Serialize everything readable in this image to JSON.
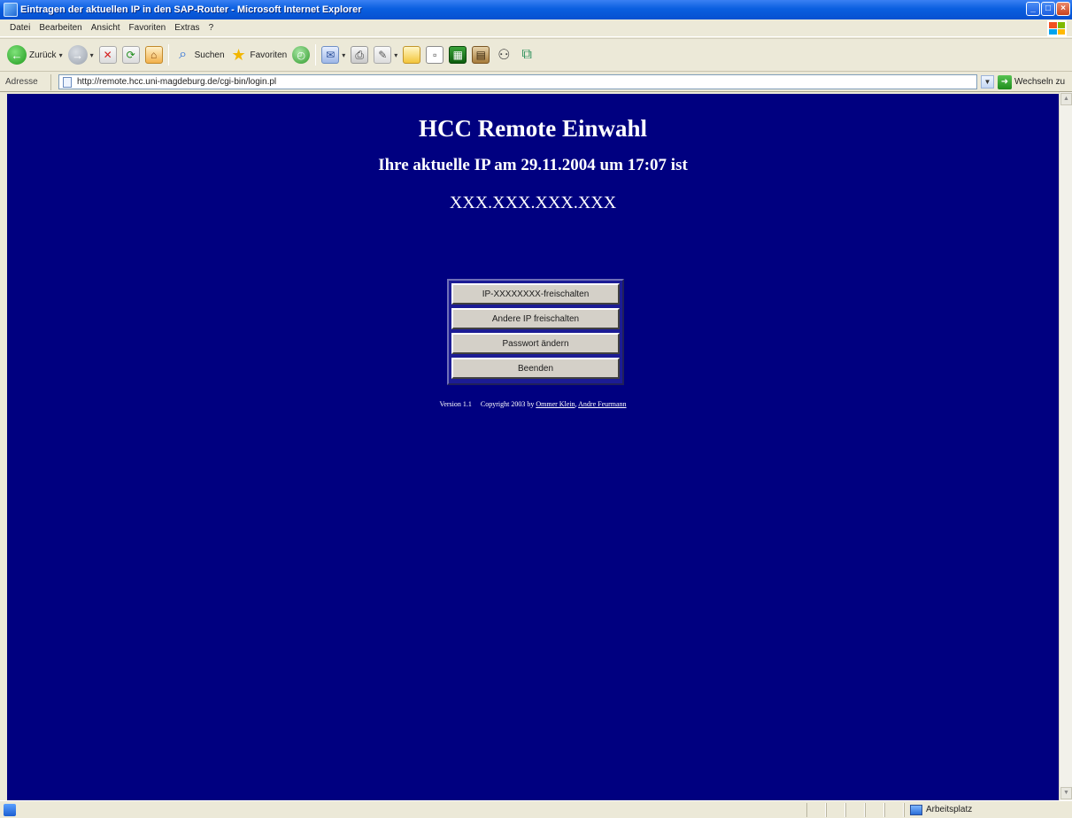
{
  "window": {
    "title": "Eintragen der aktuellen IP in den SAP-Router - Microsoft Internet Explorer",
    "controls": {
      "minimize": "_",
      "maximize": "□",
      "close": "×"
    }
  },
  "menubar": {
    "items": [
      "Datei",
      "Bearbeiten",
      "Ansicht",
      "Favoriten",
      "Extras",
      "?"
    ]
  },
  "toolbar": {
    "back_label": "Zurück",
    "search_label": "Suchen",
    "favorites_label": "Favoriten"
  },
  "address": {
    "label": "Adresse",
    "url": "http://remote.hcc.uni-magdeburg.de/cgi-bin/login.pl",
    "go_label": "Wechseln zu"
  },
  "page": {
    "heading": "HCC Remote Einwahl",
    "subheading": "Ihre aktuelle IP am 29.11.2004 um 17:07 ist",
    "ip": "XXX.XXX.XXX.XXX",
    "buttons": [
      "IP-XXXXXXXX-freischalten",
      "Andere IP freischalten",
      "Passwort ändern",
      "Beenden"
    ],
    "footer": {
      "version": "Version 1.1",
      "copyright": "Copyright 2003 by",
      "author1": "Ommer Klein",
      "separator": ",",
      "author2": "Andre Feurmann"
    }
  },
  "status": {
    "text": "",
    "zone": "Arbeitsplatz"
  },
  "colors": {
    "page_background": "#000080",
    "page_text": "#ffffff",
    "titlebar": "#0a5fe0"
  }
}
